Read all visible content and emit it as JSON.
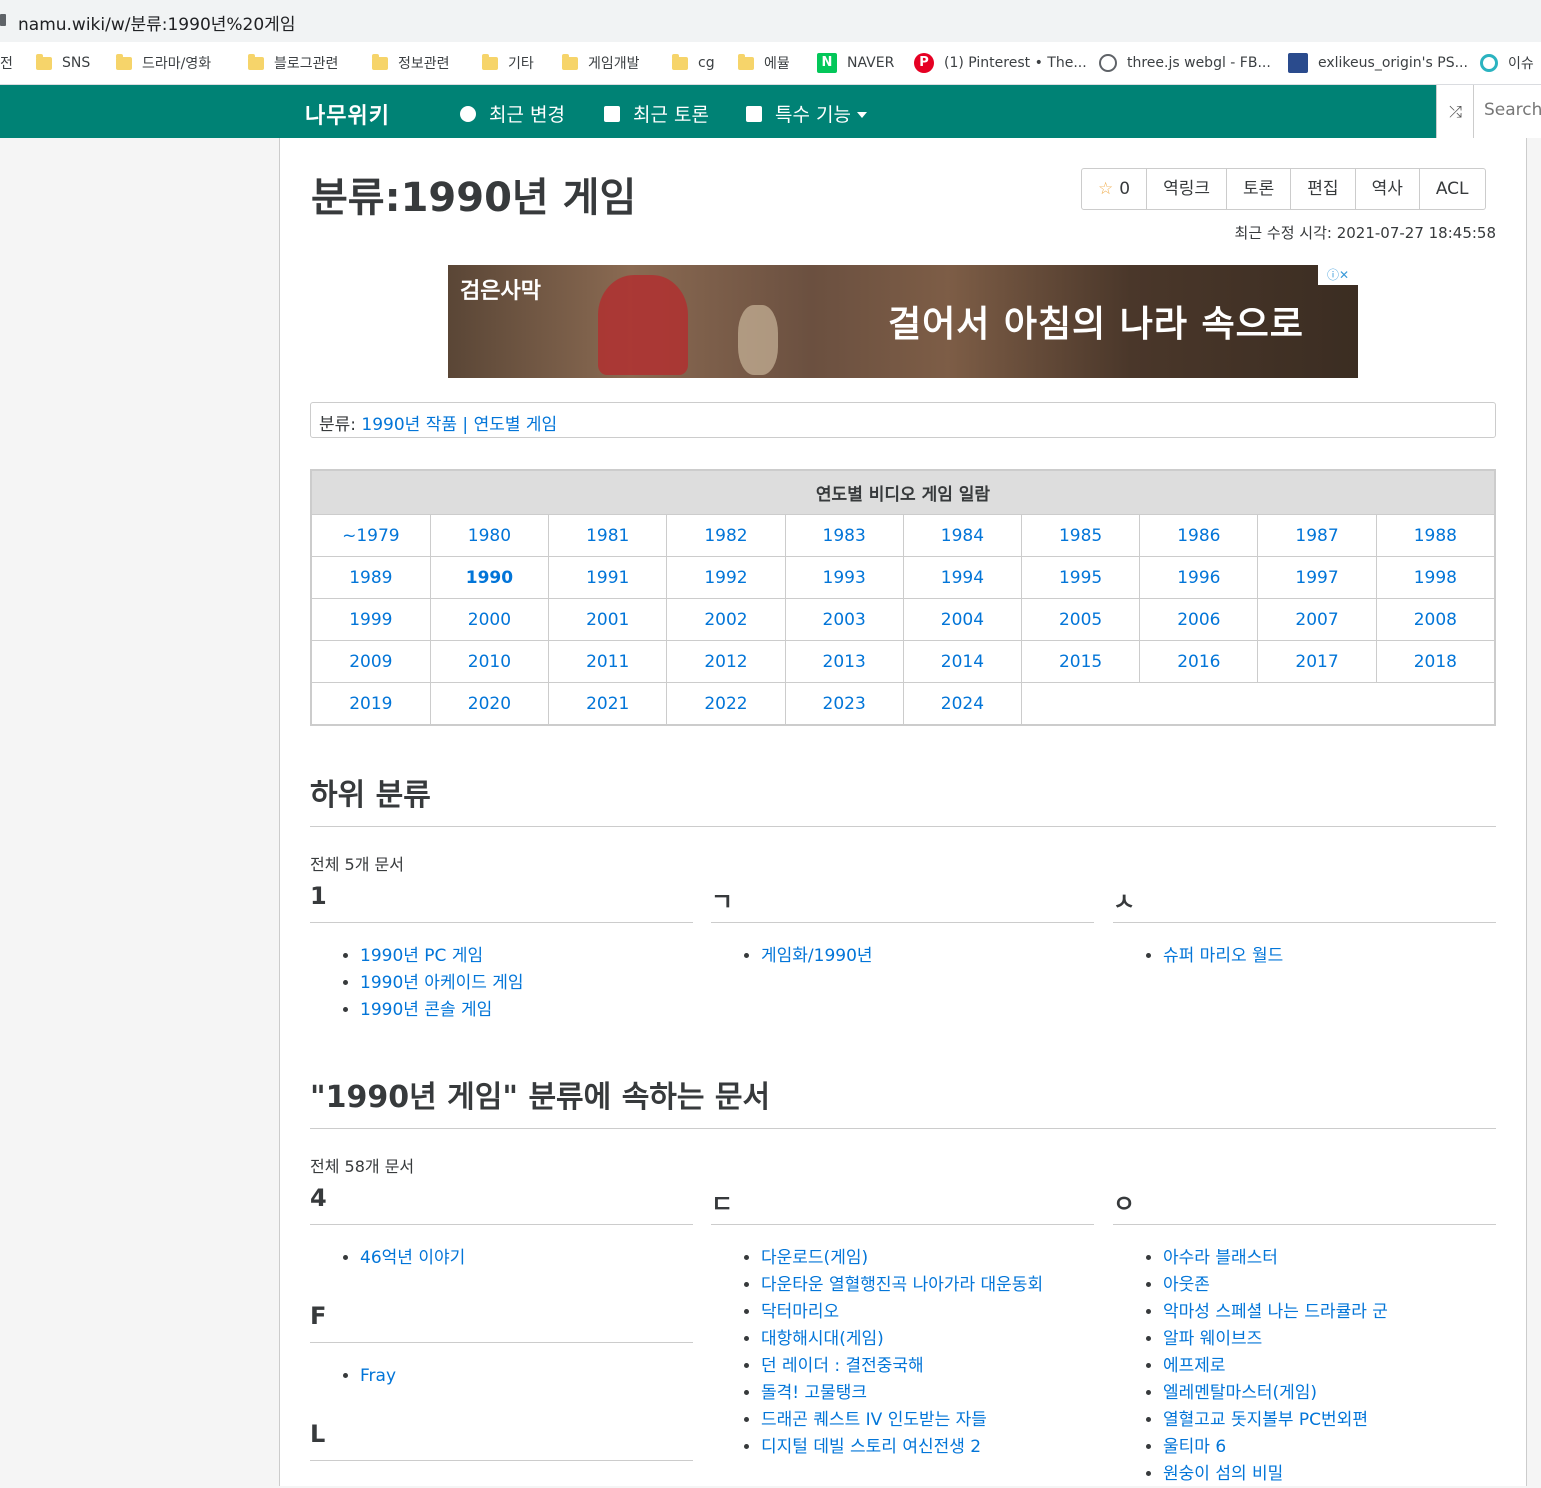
{
  "browser": {
    "url": "namu.wiki/w/분류:1990년%20게임",
    "bookmarks": [
      {
        "label": "전",
        "icon": "none"
      },
      {
        "label": "SNS",
        "icon": "folder-icon"
      },
      {
        "label": "드라마/영화",
        "icon": "folder-icon"
      },
      {
        "label": "블로그관련",
        "icon": "folder-icon"
      },
      {
        "label": "정보관련",
        "icon": "folder-icon"
      },
      {
        "label": "기타",
        "icon": "folder-icon"
      },
      {
        "label": "게임개발",
        "icon": "folder-icon"
      },
      {
        "label": "cg",
        "icon": "folder-icon"
      },
      {
        "label": "에뮬",
        "icon": "folder-icon"
      },
      {
        "label": "NAVER",
        "icon": "naver-icon"
      },
      {
        "label": "(1) Pinterest • The...",
        "icon": "pinterest-icon"
      },
      {
        "label": "three.js webgl - FB...",
        "icon": "globe-icon"
      },
      {
        "label": "exlikeus_origin's PS...",
        "icon": "trophy-icon"
      },
      {
        "label": "이슈",
        "icon": "issue-icon"
      }
    ]
  },
  "nav": {
    "logo": "나무위키",
    "recent_changes": "최근 변경",
    "recent_discuss": "최근 토론",
    "special": "특수 기능",
    "search_placeholder": "Search"
  },
  "page": {
    "title": "분류:1990년 게임",
    "star_count": "0",
    "tools": [
      "역링크",
      "토론",
      "편집",
      "역사",
      "ACL"
    ],
    "last_modified": "최근 수정 시각: 2021-07-27 18:45:58"
  },
  "ad": {
    "brand": "검은사막",
    "tagline": "걸어서 아침의 나라 속으로"
  },
  "categories": {
    "label": "분류:",
    "items": [
      "1990년 작품",
      "연도별 게임"
    ],
    "separator": "|"
  },
  "year_table": {
    "header": "연도별 비디오 게임 일람",
    "rows": [
      [
        "~1979",
        "1980",
        "1981",
        "1982",
        "1983",
        "1984",
        "1985",
        "1986",
        "1987",
        "1988"
      ],
      [
        "1989",
        "1990",
        "1991",
        "1992",
        "1993",
        "1994",
        "1995",
        "1996",
        "1997",
        "1998"
      ],
      [
        "1999",
        "2000",
        "2001",
        "2002",
        "2003",
        "2004",
        "2005",
        "2006",
        "2007",
        "2008"
      ],
      [
        "2009",
        "2010",
        "2011",
        "2012",
        "2013",
        "2014",
        "2015",
        "2016",
        "2017",
        "2018"
      ],
      [
        "2019",
        "2020",
        "2021",
        "2022",
        "2023",
        "2024"
      ]
    ],
    "current": "1990"
  },
  "subcategories": {
    "heading": "하위 분류",
    "count": "전체 5개 문서",
    "groups": [
      {
        "letter": "1",
        "items": [
          "1990년 PC 게임",
          "1990년 아케이드 게임",
          "1990년 콘솔 게임"
        ]
      },
      {
        "letter": "ㄱ",
        "items": [
          "게임화/1990년"
        ]
      },
      {
        "letter": "ㅅ",
        "items": [
          "슈퍼 마리오 월드"
        ]
      }
    ]
  },
  "documents": {
    "heading": "\"1990년 게임\" 분류에 속하는 문서",
    "count": "전체 58개 문서",
    "col1": [
      {
        "letter": "4",
        "items": [
          "46억년 이야기"
        ]
      },
      {
        "letter": "F",
        "items": [
          "Fray"
        ]
      },
      {
        "letter": "L",
        "items": []
      }
    ],
    "col2": [
      {
        "letter": "ㄷ",
        "items": [
          "다운로드(게임)",
          "다운타운 열혈행진곡 나아가라 대운동회",
          "닥터마리오",
          "대항해시대(게임)",
          "던 레이더 : 결전중국해",
          "돌격! 고물탱크",
          "드래곤 퀘스트 IV 인도받는 자들",
          "디지털 데빌 스토리 여신전생 2"
        ]
      }
    ],
    "col3": [
      {
        "letter": "ㅇ",
        "items": [
          "아수라 블래스터",
          "아웃존",
          "악마성 스페셜 나는 드라큘라 군",
          "알파 웨이브즈",
          "에프제로",
          "엘레멘탈마스터(게임)",
          "열혈고교 돗지볼부 PC번외편",
          "울티마 6",
          "원숭이 섬의 비밀"
        ]
      }
    ]
  }
}
